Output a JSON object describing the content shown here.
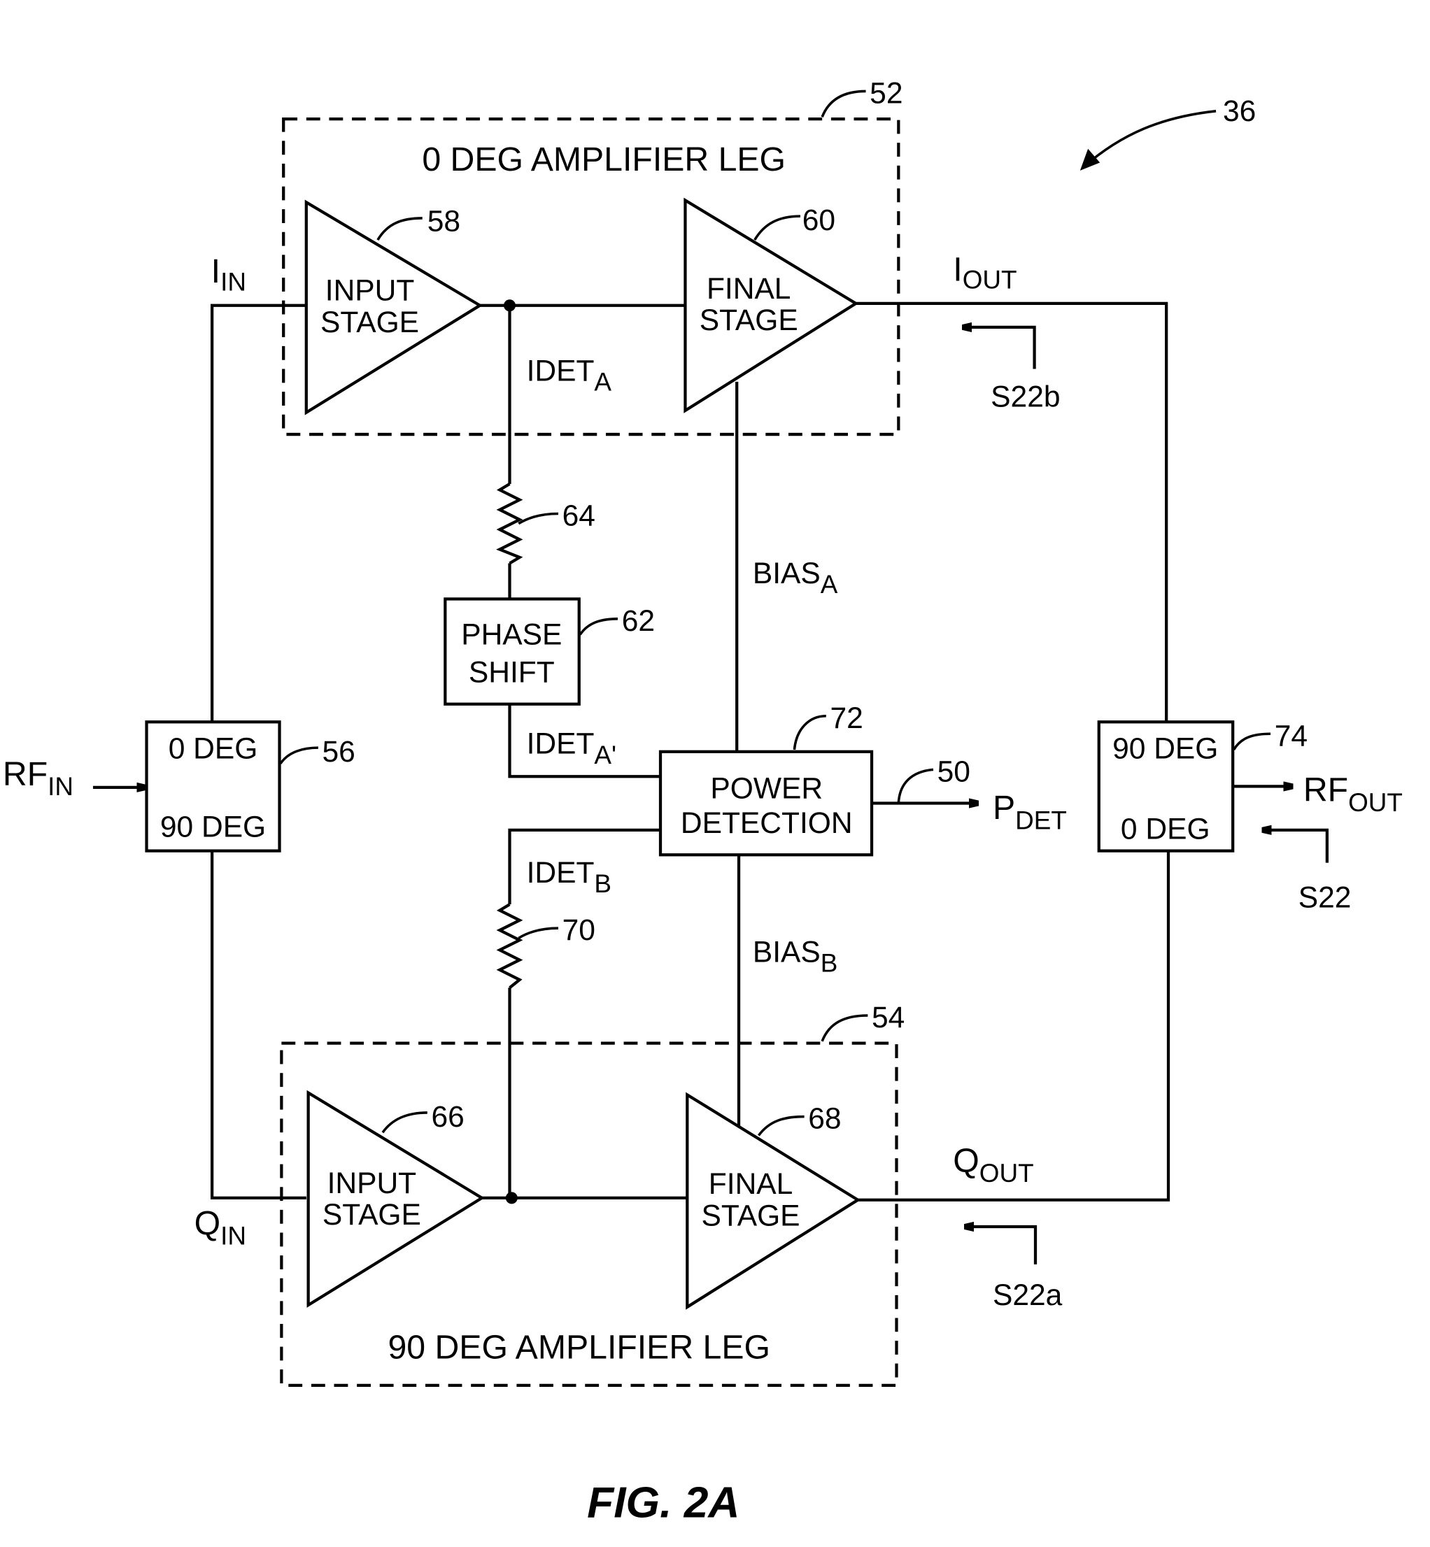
{
  "figure": {
    "caption": "FIG. 2A",
    "reference_number": "36"
  },
  "legs": {
    "top": {
      "label": "0 DEG AMPLIFIER LEG",
      "ref": "52"
    },
    "bottom": {
      "label": "90 DEG AMPLIFIER LEG",
      "ref": "54"
    }
  },
  "amplifiers": {
    "a_input": {
      "line1": "INPUT",
      "line2": "STAGE",
      "ref": "58"
    },
    "a_final": {
      "line1": "FINAL",
      "line2": "STAGE",
      "ref": "60"
    },
    "b_input": {
      "line1": "INPUT",
      "line2": "STAGE",
      "ref": "66"
    },
    "b_final": {
      "line1": "FINAL",
      "line2": "STAGE",
      "ref": "68"
    }
  },
  "blocks": {
    "input_hybrid": {
      "line1": "0 DEG",
      "line2": "90 DEG",
      "ref": "56"
    },
    "output_hybrid": {
      "line1": "90 DEG",
      "line2": "0 DEG",
      "ref": "74"
    },
    "phase_shift": {
      "line1": "PHASE",
      "line2": "SHIFT",
      "ref": "62"
    },
    "power_detection": {
      "line1": "POWER",
      "line2": "DETECTION",
      "ref": "72"
    }
  },
  "resistors": {
    "r_a": {
      "ref": "64"
    },
    "r_b": {
      "ref": "70"
    }
  },
  "signals": {
    "rf_in": {
      "main": "RF",
      "sub": "IN"
    },
    "rf_out": {
      "main": "RF",
      "sub": "OUT"
    },
    "i_in": {
      "main": "I",
      "sub": "IN"
    },
    "q_in": {
      "main": "Q",
      "sub": "IN"
    },
    "i_out": {
      "main": "I",
      "sub": "OUT"
    },
    "q_out": {
      "main": "Q",
      "sub": "OUT"
    },
    "idet_a": {
      "main": "IDET",
      "sub": "A"
    },
    "idet_a_prime": {
      "main": "IDET",
      "sub": "A'"
    },
    "idet_b": {
      "main": "IDET",
      "sub": "B"
    },
    "bias_a": {
      "main": "BIAS",
      "sub": "A"
    },
    "bias_b": {
      "main": "BIAS",
      "sub": "B"
    },
    "p_det": {
      "main": "P",
      "sub": "DET",
      "ref": "50"
    },
    "s22": "S22",
    "s22a": "S22a",
    "s22b": "S22b"
  }
}
